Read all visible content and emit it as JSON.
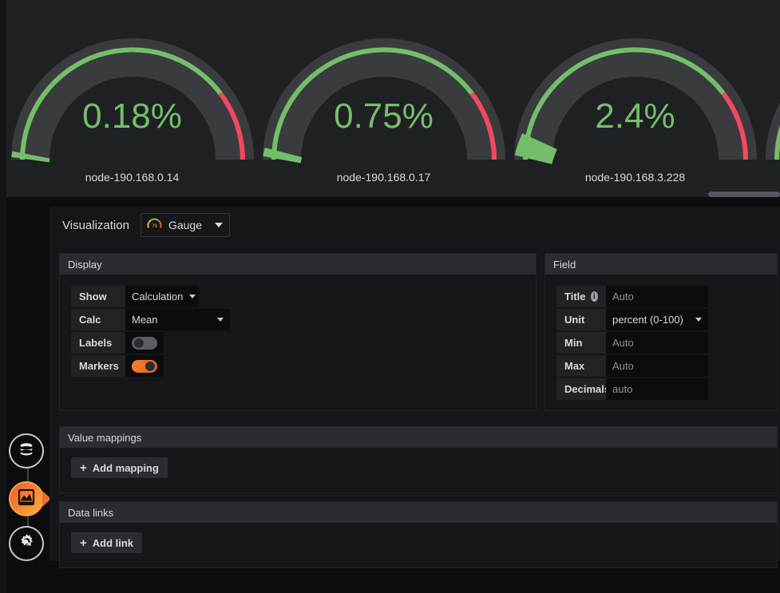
{
  "panel": {
    "gauges": [
      {
        "value": "0.18%",
        "label": "node-190.168.0.14",
        "pct": 0.18
      },
      {
        "value": "0.75%",
        "label": "node-190.168.0.17",
        "pct": 0.75
      },
      {
        "value": "2.4%",
        "label": "node-190.168.3.228",
        "pct": 2.4
      },
      {
        "value": "",
        "label": "",
        "pct": 0.0
      }
    ],
    "colors": {
      "green": "#73bf69",
      "red": "#f2495c",
      "track": "#3a3b3f",
      "panel_bg": "#1f2023",
      "inner_bg": "#202226"
    },
    "scrollbar": {
      "name": "horizontal-scrollbar"
    }
  },
  "sidebar": {
    "items": [
      {
        "icon": "database-icon",
        "name": "queries-tab",
        "active": false
      },
      {
        "icon": "visualization-icon",
        "name": "visualization-tab",
        "active": true
      },
      {
        "icon": "gear-wrench-icon",
        "name": "general-settings-tab",
        "active": false
      }
    ]
  },
  "visualization": {
    "label": "Visualization",
    "selected": "Gauge",
    "icon": "gauge-icon",
    "icon_value": "79"
  },
  "display": {
    "title": "Display",
    "rows": [
      {
        "label": "Show",
        "type": "select",
        "value": "Calculation"
      },
      {
        "label": "Calc",
        "type": "select",
        "value": "Mean"
      },
      {
        "label": "Labels",
        "type": "toggle",
        "value": "off"
      },
      {
        "label": "Markers",
        "type": "toggle",
        "value": "on"
      }
    ]
  },
  "field": {
    "title": "Field",
    "rows": [
      {
        "label": "Title",
        "type": "input",
        "value": "",
        "placeholder": "Auto",
        "info": true
      },
      {
        "label": "Unit",
        "type": "select",
        "value": "percent (0-100)"
      },
      {
        "label": "Min",
        "type": "input",
        "value": "",
        "placeholder": "Auto"
      },
      {
        "label": "Max",
        "type": "input",
        "value": "",
        "placeholder": "Auto"
      },
      {
        "label": "Decimals",
        "type": "input",
        "value": "",
        "placeholder": "auto"
      }
    ]
  },
  "value_mappings": {
    "title": "Value mappings",
    "add_label": "Add mapping",
    "plus": "+"
  },
  "data_links": {
    "title": "Data links",
    "add_label": "Add link",
    "plus": "+"
  }
}
